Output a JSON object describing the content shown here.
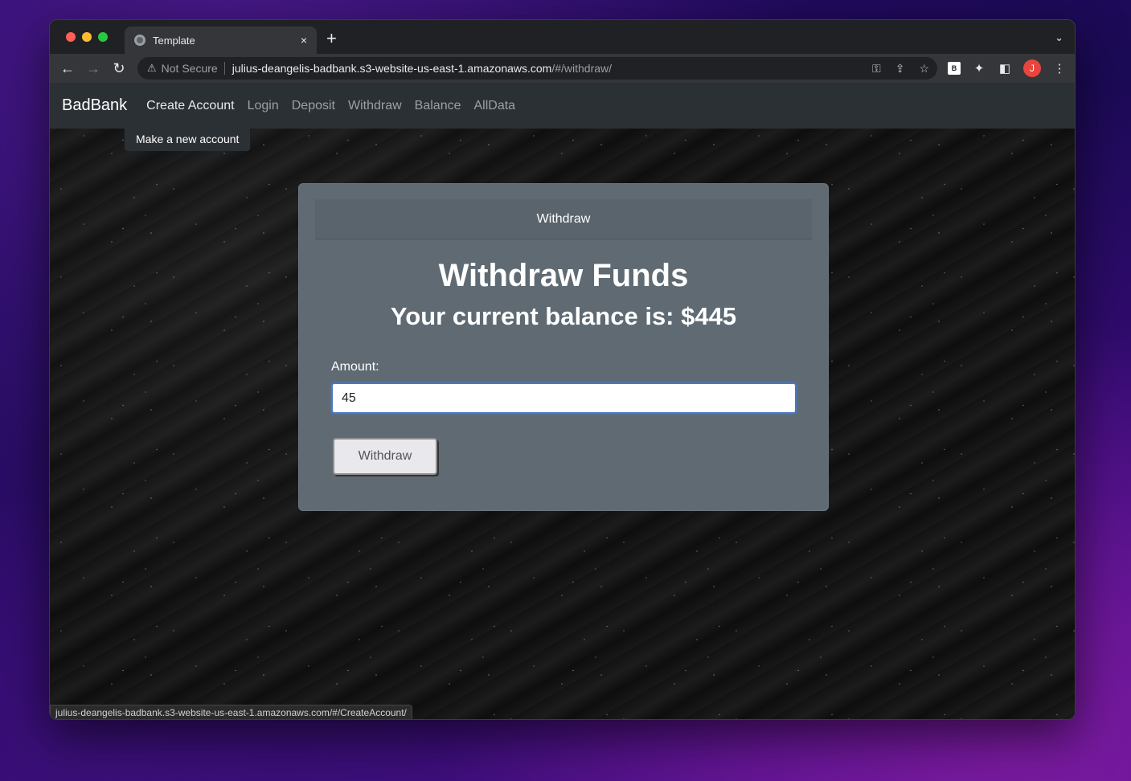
{
  "browser": {
    "tab_title": "Template",
    "tab_close": "×",
    "new_tab": "+",
    "tab_menu": "⌄",
    "not_secure": "Not Secure",
    "url_host": "julius-deangelis-badbank.s3-website-us-east-1.amazonaws.com",
    "url_path": "/#/withdraw/",
    "avatar_initial": "J",
    "ext_badge": "B"
  },
  "navbar": {
    "brand": "BadBank",
    "links": [
      "Create Account",
      "Login",
      "Deposit",
      "Withdraw",
      "Balance",
      "AllData"
    ],
    "tooltip": "Make a new account"
  },
  "card": {
    "header": "Withdraw",
    "title": "Withdraw Funds",
    "balance": "Your current balance is: $445",
    "amount_label": "Amount:",
    "amount_value": "45",
    "button_label": "Withdraw"
  },
  "status_url": "julius-deangelis-badbank.s3-website-us-east-1.amazonaws.com/#/CreateAccount/"
}
